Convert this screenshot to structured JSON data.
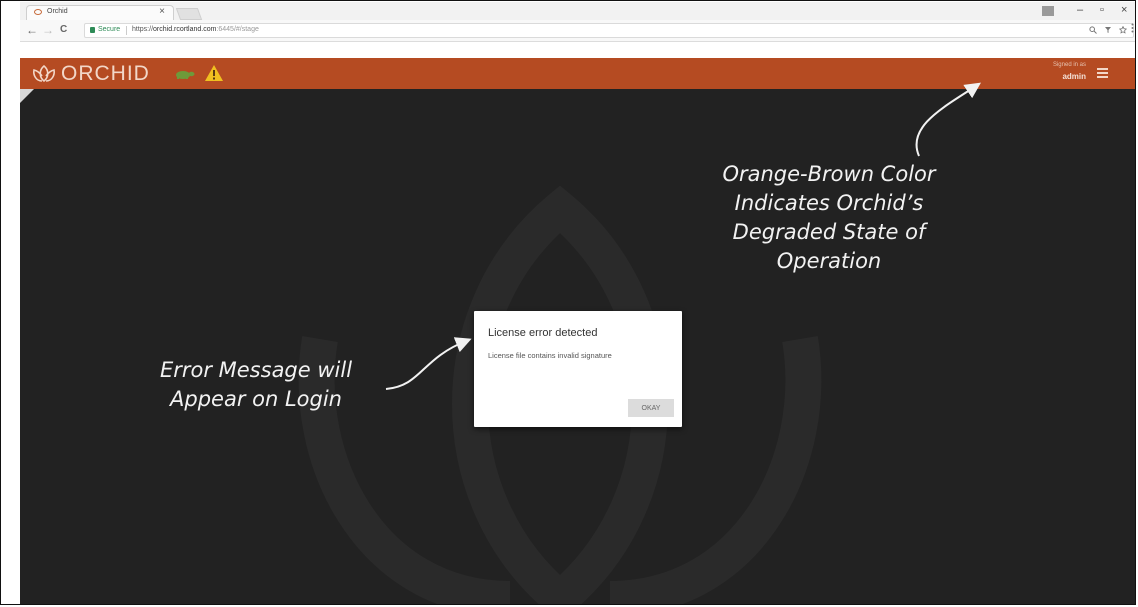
{
  "browser": {
    "tab_title": "Orchid",
    "tab_close": "×",
    "secure_label": "Secure",
    "url_scheme": "https://",
    "url_host": "orchid.rcortland.com",
    "url_path": ":6445/#/stage",
    "window_controls": [
      "–",
      "▫",
      "×"
    ],
    "nav": {
      "back": "←",
      "forward": "→",
      "reload": "C"
    }
  },
  "app": {
    "name": "ORCHID",
    "header_color": "#b54b22",
    "signed_in_label": "Signed in as",
    "user": "admin",
    "icons": [
      "orchid-logo-icon",
      "turtle-icon",
      "warning-icon",
      "hamburger-menu-icon"
    ]
  },
  "dialog": {
    "title": "License error detected",
    "message": "License file contains invalid signature",
    "okay_label": "OKAY"
  },
  "annotations": {
    "left_lines": [
      "Error Message will",
      "Appear on Login"
    ],
    "right_lines": [
      "Orange-Brown Color",
      "Indicates Orchid’s",
      "Degraded State of",
      "Operation"
    ]
  }
}
